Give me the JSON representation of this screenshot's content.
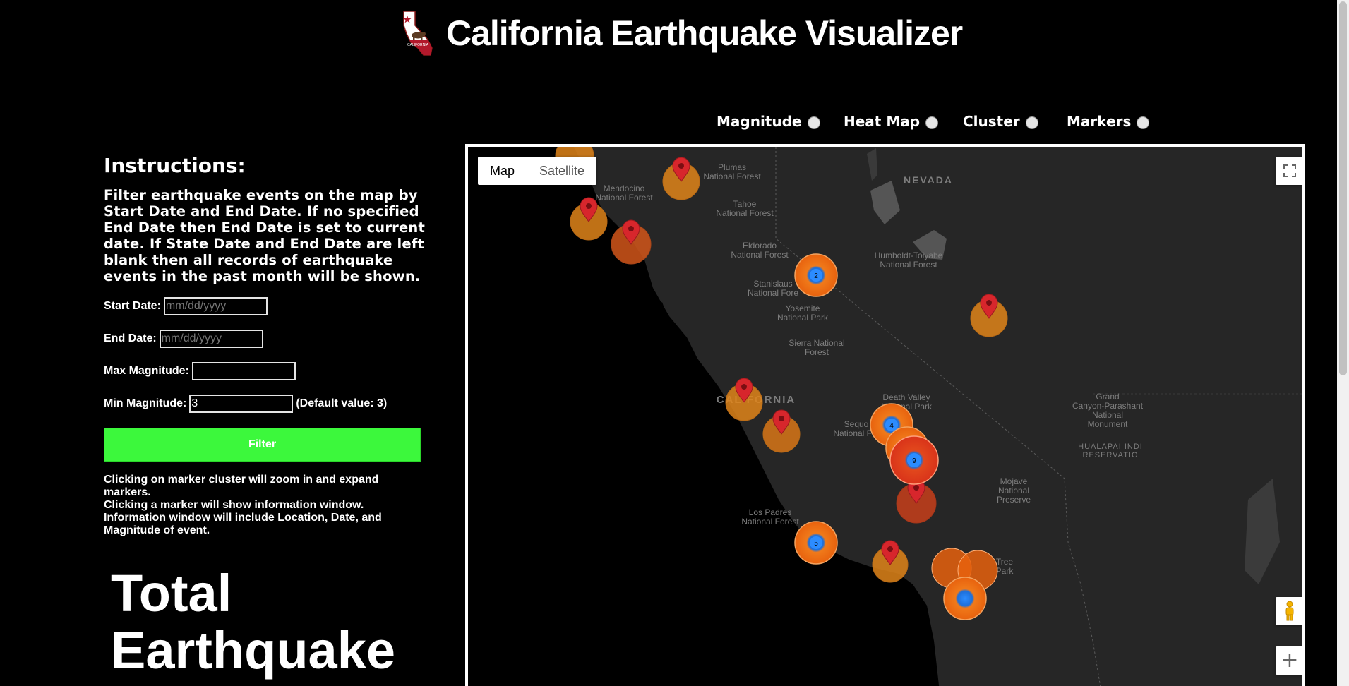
{
  "header": {
    "title": "California Earthquake Visualizer",
    "logo_icon": "california-flag-state-icon"
  },
  "layers": [
    {
      "label": "Magnitude",
      "selected": false
    },
    {
      "label": "Heat Map",
      "selected": false
    },
    {
      "label": "Cluster",
      "selected": false
    },
    {
      "label": "Markers",
      "selected": false
    }
  ],
  "panel": {
    "heading": "Instructions:",
    "instructions": "Filter earthquake events on the map by Start Date and End Date. If no specified End Date then End Date is set to current date. If State Date and End Date are left blank then all records of earthquake events in the past month will be shown.",
    "start_date": {
      "label": "Start Date:",
      "placeholder": "mm/dd/yyyy",
      "value": ""
    },
    "end_date": {
      "label": "End Date:",
      "placeholder": "mm/dd/yyyy",
      "value": ""
    },
    "max_magnitude": {
      "label": "Max Magnitude:",
      "value": ""
    },
    "min_magnitude": {
      "label": "Min Magnitude:",
      "value": "3",
      "note": "(Default value: 3)"
    },
    "filter_button": "Filter",
    "help_line1": "Clicking on marker cluster will zoom in and expand markers.",
    "help_line2": "Clicking a marker will show information window.",
    "help_line3": "Information window will include Location, Date, and Magnitude of event.",
    "total_title_line1": "Total",
    "total_title_line2": "Earthquake"
  },
  "map": {
    "map_type_options": [
      "Map",
      "Satellite"
    ],
    "active_map_type": "Map",
    "labels": {
      "nevada": "NEVADA",
      "california": "CALIFORNIA",
      "plumas": [
        "Plumas",
        "National Forest"
      ],
      "mendocino": [
        "Mendocino",
        "National Forest"
      ],
      "tahoe": [
        "Tahoe",
        "National Forest"
      ],
      "eldorado": [
        "Eldorado",
        "National Forest"
      ],
      "humboldt": [
        "Humboldt-Toiyabe",
        "National Forest"
      ],
      "stanislaus": [
        "Stanislaus",
        "National Fore"
      ],
      "yosemite": [
        "Yosemite",
        "National Park"
      ],
      "sierra": [
        "Sierra National",
        "Forest"
      ],
      "death_valley": [
        "Death Valley",
        "National Park"
      ],
      "sequoia": [
        "Sequo",
        "National Fo"
      ],
      "grand_canyon": [
        "Grand",
        "Canyon-Parashant",
        "National",
        "Monument"
      ],
      "hualapai": [
        "HUALAPAI INDI",
        "RESERVATIO"
      ],
      "mojave": [
        "Mojave",
        "National",
        "Preserve"
      ],
      "los_padres": [
        "Los Padres",
        "National Forest"
      ],
      "joshua": [
        "Tree",
        "Park"
      ]
    },
    "clusters": [
      {
        "count": "2",
        "color": "#e8620e"
      },
      {
        "count": "4",
        "color": "#e8620e"
      },
      {
        "count": "9",
        "color": "#d9331a"
      },
      {
        "count": "5",
        "color": "#e8620e"
      }
    ],
    "marker_color": "#d7262c",
    "circle_colors": {
      "orange": "#e0851a",
      "dark_orange": "#d2561a",
      "red_orange": "#c8401b"
    }
  },
  "colors": {
    "filter_button": "#3cf83c",
    "background": "#000000",
    "map_land": "#262626",
    "map_water": "#000000"
  }
}
